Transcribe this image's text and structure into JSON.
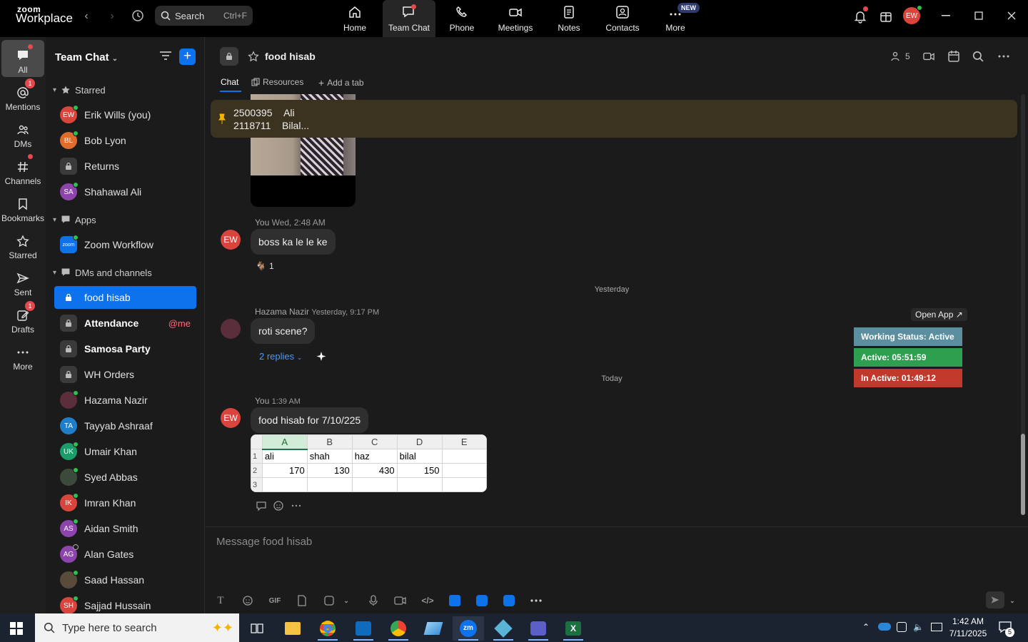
{
  "app": {
    "logo_top": "zoom",
    "logo_bottom": "Workplace"
  },
  "search": {
    "label": "Search",
    "shortcut": "Ctrl+F"
  },
  "topnav": [
    {
      "label": "Home"
    },
    {
      "label": "Team Chat"
    },
    {
      "label": "Phone"
    },
    {
      "label": "Meetings"
    },
    {
      "label": "Notes"
    },
    {
      "label": "Contacts"
    },
    {
      "label": "More",
      "badge": "NEW"
    }
  ],
  "user_avatar": "EW",
  "rail": [
    {
      "label": "All"
    },
    {
      "label": "Mentions",
      "badge": "1"
    },
    {
      "label": "DMs"
    },
    {
      "label": "Channels"
    },
    {
      "label": "Bookmarks"
    },
    {
      "label": "Starred"
    },
    {
      "label": "Sent"
    },
    {
      "label": "Drafts",
      "badge": "1"
    },
    {
      "label": "More"
    }
  ],
  "sidebar": {
    "title": "Team Chat",
    "sections": {
      "starred": "Starred",
      "apps": "Apps",
      "dms": "DMs and channels"
    },
    "starred": [
      {
        "label": "Erik Wills (you)",
        "initials": "EW",
        "color": "#d9453d"
      },
      {
        "label": "Bob Lyon",
        "initials": "BL",
        "color": "#e06c2b"
      },
      {
        "label": "Returns"
      },
      {
        "label": "Shahawal Ali",
        "initials": "SA",
        "color": "#8e44ad"
      }
    ],
    "apps": [
      {
        "label": "Zoom Workflow",
        "initials": "zoom",
        "color": "#0e72ed"
      }
    ],
    "dms": [
      {
        "label": "food hisab"
      },
      {
        "label": "Attendance",
        "mention": "@me"
      },
      {
        "label": "Samosa Party"
      },
      {
        "label": "WH Orders"
      },
      {
        "label": "Hazama Nazir",
        "color": "#5a2e3a"
      },
      {
        "label": "Tayyab Ashraaf",
        "initials": "TA",
        "color": "#1f7ec9"
      },
      {
        "label": "Umair Khan",
        "initials": "UK",
        "color": "#1a9c6b"
      },
      {
        "label": "Syed Abbas",
        "color": "#3c4a3c"
      },
      {
        "label": "Imran Khan",
        "initials": "IK",
        "color": "#d9453d"
      },
      {
        "label": "Aidan Smith",
        "initials": "AS",
        "color": "#8e44ad"
      },
      {
        "label": "Alan Gates",
        "initials": "AG",
        "color": "#8e44ad"
      },
      {
        "label": "Saad Hassan",
        "color": "#5a4a3a"
      },
      {
        "label": "Sajjad Hussain",
        "initials": "SH",
        "color": "#d9453d"
      }
    ]
  },
  "channel": {
    "title": "food hisab",
    "member_count": "5",
    "tabs": {
      "chat": "Chat",
      "resources": "Resources",
      "add": "Add a tab"
    }
  },
  "pinned": {
    "line1_id": "2500395",
    "line1_name": "Ali",
    "line2_id": "2118711",
    "line2_name": "Bilal..."
  },
  "messages": {
    "m1": {
      "author": "You",
      "time": "Wed, 2:48 AM",
      "text": "boss ka le le ke",
      "avatar": "EW",
      "reaction_count": "1"
    },
    "sep_yesterday": "Yesterday",
    "m2": {
      "author": "Hazama Nazir",
      "time": "Yesterday, 9:17 PM",
      "text": "roti scene?",
      "replies": "2 replies"
    },
    "sep_today": "Today",
    "m3": {
      "author": "You",
      "time": "1:39 AM",
      "text": "food hisab for 7/10/225",
      "avatar": "EW"
    }
  },
  "sheet": {
    "columns": [
      "A",
      "B",
      "C",
      "D",
      "E"
    ],
    "rows": [
      {
        "n": "1",
        "cells": [
          "ali",
          "shah",
          "haz",
          "bilal",
          ""
        ]
      },
      {
        "n": "2",
        "cells": [
          "170",
          "130",
          "430",
          "150",
          ""
        ]
      },
      {
        "n": "3",
        "cells": [
          "",
          "",
          "",
          "",
          ""
        ]
      }
    ]
  },
  "status_widget": {
    "open_app": "Open App ↗",
    "working": "Working Status: Active",
    "active": "Active: 05:51:59",
    "inactive": "In Active: 01:49:12",
    "colors": {
      "working": "#5b8fa0",
      "active": "#2e9e4f",
      "inactive": "#c0392b"
    }
  },
  "compose": {
    "placeholder": "Message food hisab",
    "gif": "GIF"
  },
  "taskbar": {
    "search_placeholder": "Type here to search",
    "time": "1:42 AM",
    "date": "7/11/2025",
    "notif_count": "5"
  }
}
